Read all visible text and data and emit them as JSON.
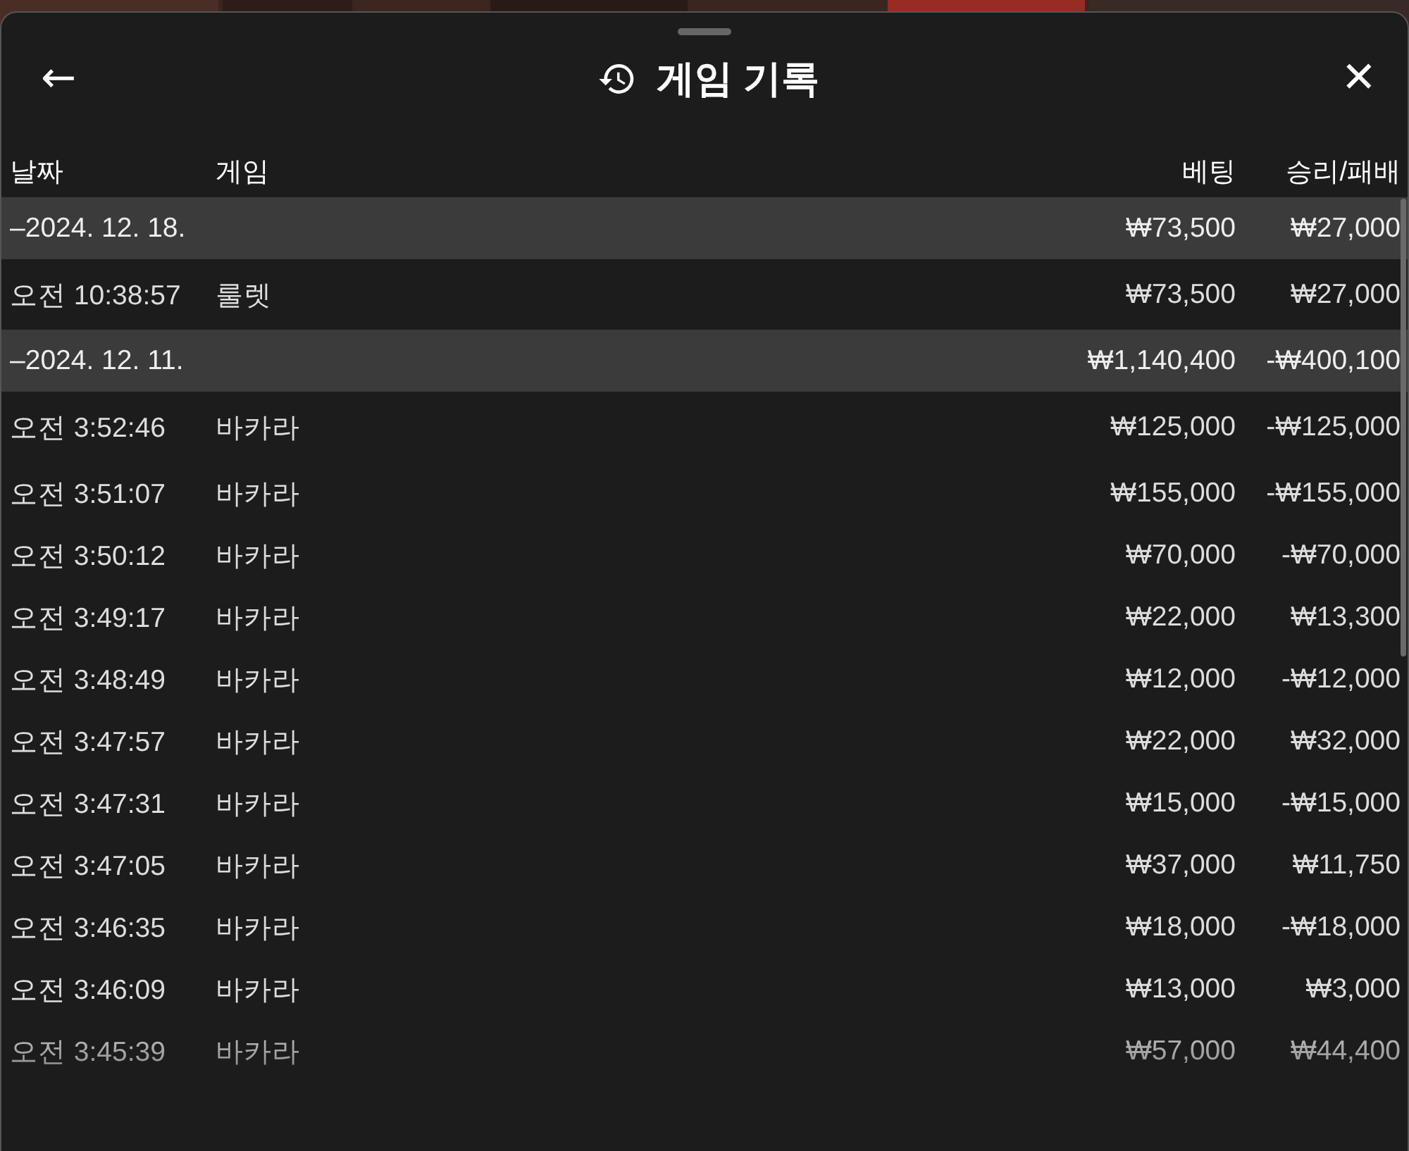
{
  "header": {
    "back": "←",
    "title": "게임 기록",
    "close": "✕"
  },
  "columns": [
    "날짜",
    "게임",
    "베팅",
    "승리/패배"
  ],
  "rows": [
    {
      "kind": "group",
      "date": "–2024. 12. 18.",
      "bet": "₩73,500",
      "result": "₩27,000"
    },
    {
      "kind": "game",
      "date": "오전 10:38:57",
      "game": "룰렛",
      "bet": "₩73,500",
      "result": "₩27,000"
    },
    {
      "kind": "group",
      "date": "–2024. 12. 11.",
      "bet": "₩1,140,400",
      "result": "-₩400,100"
    },
    {
      "kind": "game",
      "date": "오전 3:52:46",
      "game": "바카라",
      "bet": "₩125,000",
      "result": "-₩125,000"
    },
    {
      "kind": "game",
      "date": "오전 3:51:07",
      "game": "바카라",
      "bet": "₩155,000",
      "result": "-₩155,000"
    },
    {
      "kind": "game",
      "date": "오전 3:50:12",
      "game": "바카라",
      "bet": "₩70,000",
      "result": "-₩70,000"
    },
    {
      "kind": "game",
      "date": "오전 3:49:17",
      "game": "바카라",
      "bet": "₩22,000",
      "result": "₩13,300"
    },
    {
      "kind": "game",
      "date": "오전 3:48:49",
      "game": "바카라",
      "bet": "₩12,000",
      "result": "-₩12,000"
    },
    {
      "kind": "game",
      "date": "오전 3:47:57",
      "game": "바카라",
      "bet": "₩22,000",
      "result": "₩32,000"
    },
    {
      "kind": "game",
      "date": "오전 3:47:31",
      "game": "바카라",
      "bet": "₩15,000",
      "result": "-₩15,000"
    },
    {
      "kind": "game",
      "date": "오전 3:47:05",
      "game": "바카라",
      "bet": "₩37,000",
      "result": "₩11,750"
    },
    {
      "kind": "game",
      "date": "오전 3:46:35",
      "game": "바카라",
      "bet": "₩18,000",
      "result": "-₩18,000"
    },
    {
      "kind": "game",
      "date": "오전 3:46:09",
      "game": "바카라",
      "bet": "₩13,000",
      "result": "₩3,000"
    },
    {
      "kind": "game",
      "date": "오전 3:45:39",
      "game": "바카라",
      "bet": "₩57,000",
      "result": "₩44,400"
    }
  ]
}
